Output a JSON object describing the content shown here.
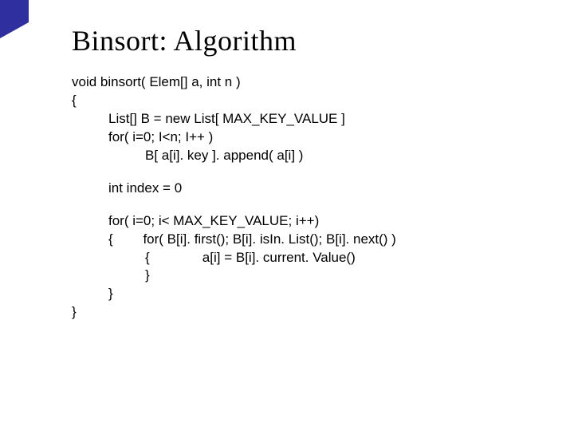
{
  "title": "Binsort: Algorithm",
  "code": {
    "l1": "void binsort( Elem[] a, int n )",
    "l2": "{",
    "l3": "List[] B = new List[ MAX_KEY_VALUE ]",
    "l4": "for( i=0; I<n; I++ )",
    "l5": "B[ a[i]. key ]. append( a[i] )",
    "l6": "int index = 0",
    "l7": "for( i=0; i< MAX_KEY_VALUE; i++)",
    "l8": "{        for( B[i]. first(); B[i]. isIn. List(); B[i]. next() )",
    "l9": "{              a[i] = B[i]. current. Value()",
    "l10": "}",
    "l11": "}",
    "l12": "}"
  }
}
